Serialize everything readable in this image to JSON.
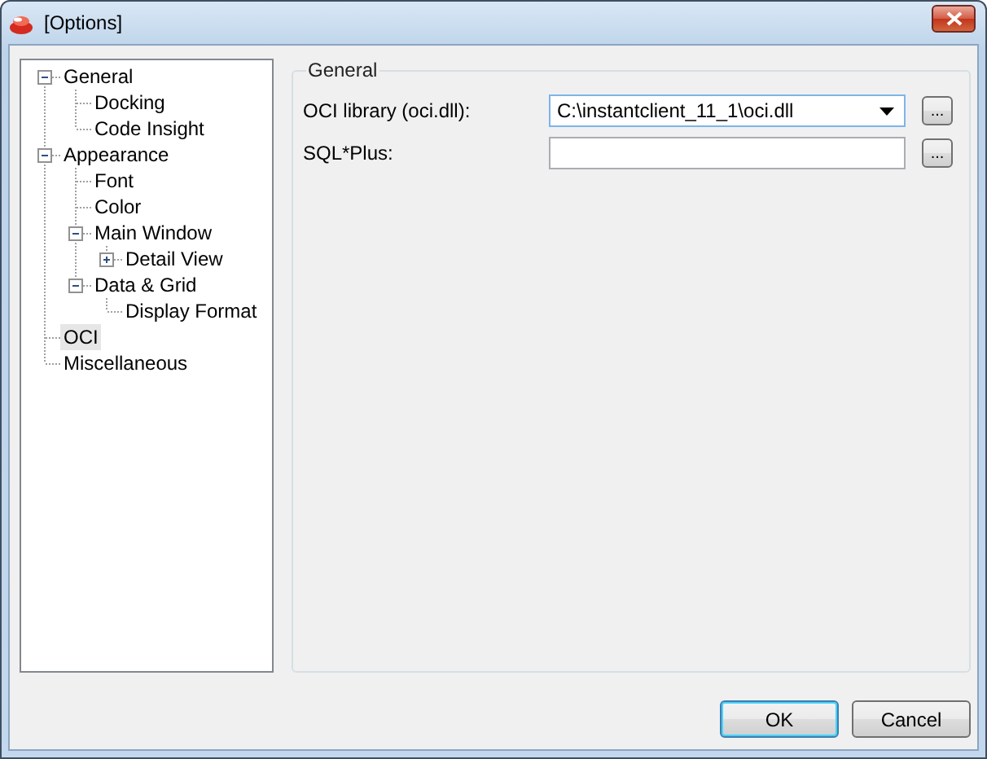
{
  "window": {
    "title": "[Options]"
  },
  "tree": [
    {
      "label": "General",
      "expanded": true,
      "selected": false,
      "children": [
        {
          "label": "Docking",
          "selected": false
        },
        {
          "label": "Code Insight",
          "selected": false
        }
      ]
    },
    {
      "label": "Appearance",
      "expanded": true,
      "selected": false,
      "children": [
        {
          "label": "Font",
          "selected": false
        },
        {
          "label": "Color",
          "selected": false
        },
        {
          "label": "Main Window",
          "expanded": true,
          "selected": false,
          "children": [
            {
              "label": "Detail View",
              "expanded": false,
              "selected": false
            }
          ]
        },
        {
          "label": "Data & Grid",
          "expanded": true,
          "selected": false,
          "children": [
            {
              "label": "Display Format",
              "selected": false
            }
          ]
        }
      ]
    },
    {
      "label": "OCI",
      "selected": true
    },
    {
      "label": "Miscellaneous",
      "selected": false
    }
  ],
  "group": {
    "title": "General",
    "fields": [
      {
        "kind": "combo",
        "label": "OCI library (oci.dll):",
        "value": "C:\\instantclient_11_1\\oci.dll",
        "browse": "..."
      },
      {
        "kind": "text",
        "label": "SQL*Plus:",
        "browse": "..."
      }
    ]
  },
  "buttons": [
    {
      "label": "OK",
      "default": true
    },
    {
      "label": "Cancel",
      "default": false
    }
  ]
}
